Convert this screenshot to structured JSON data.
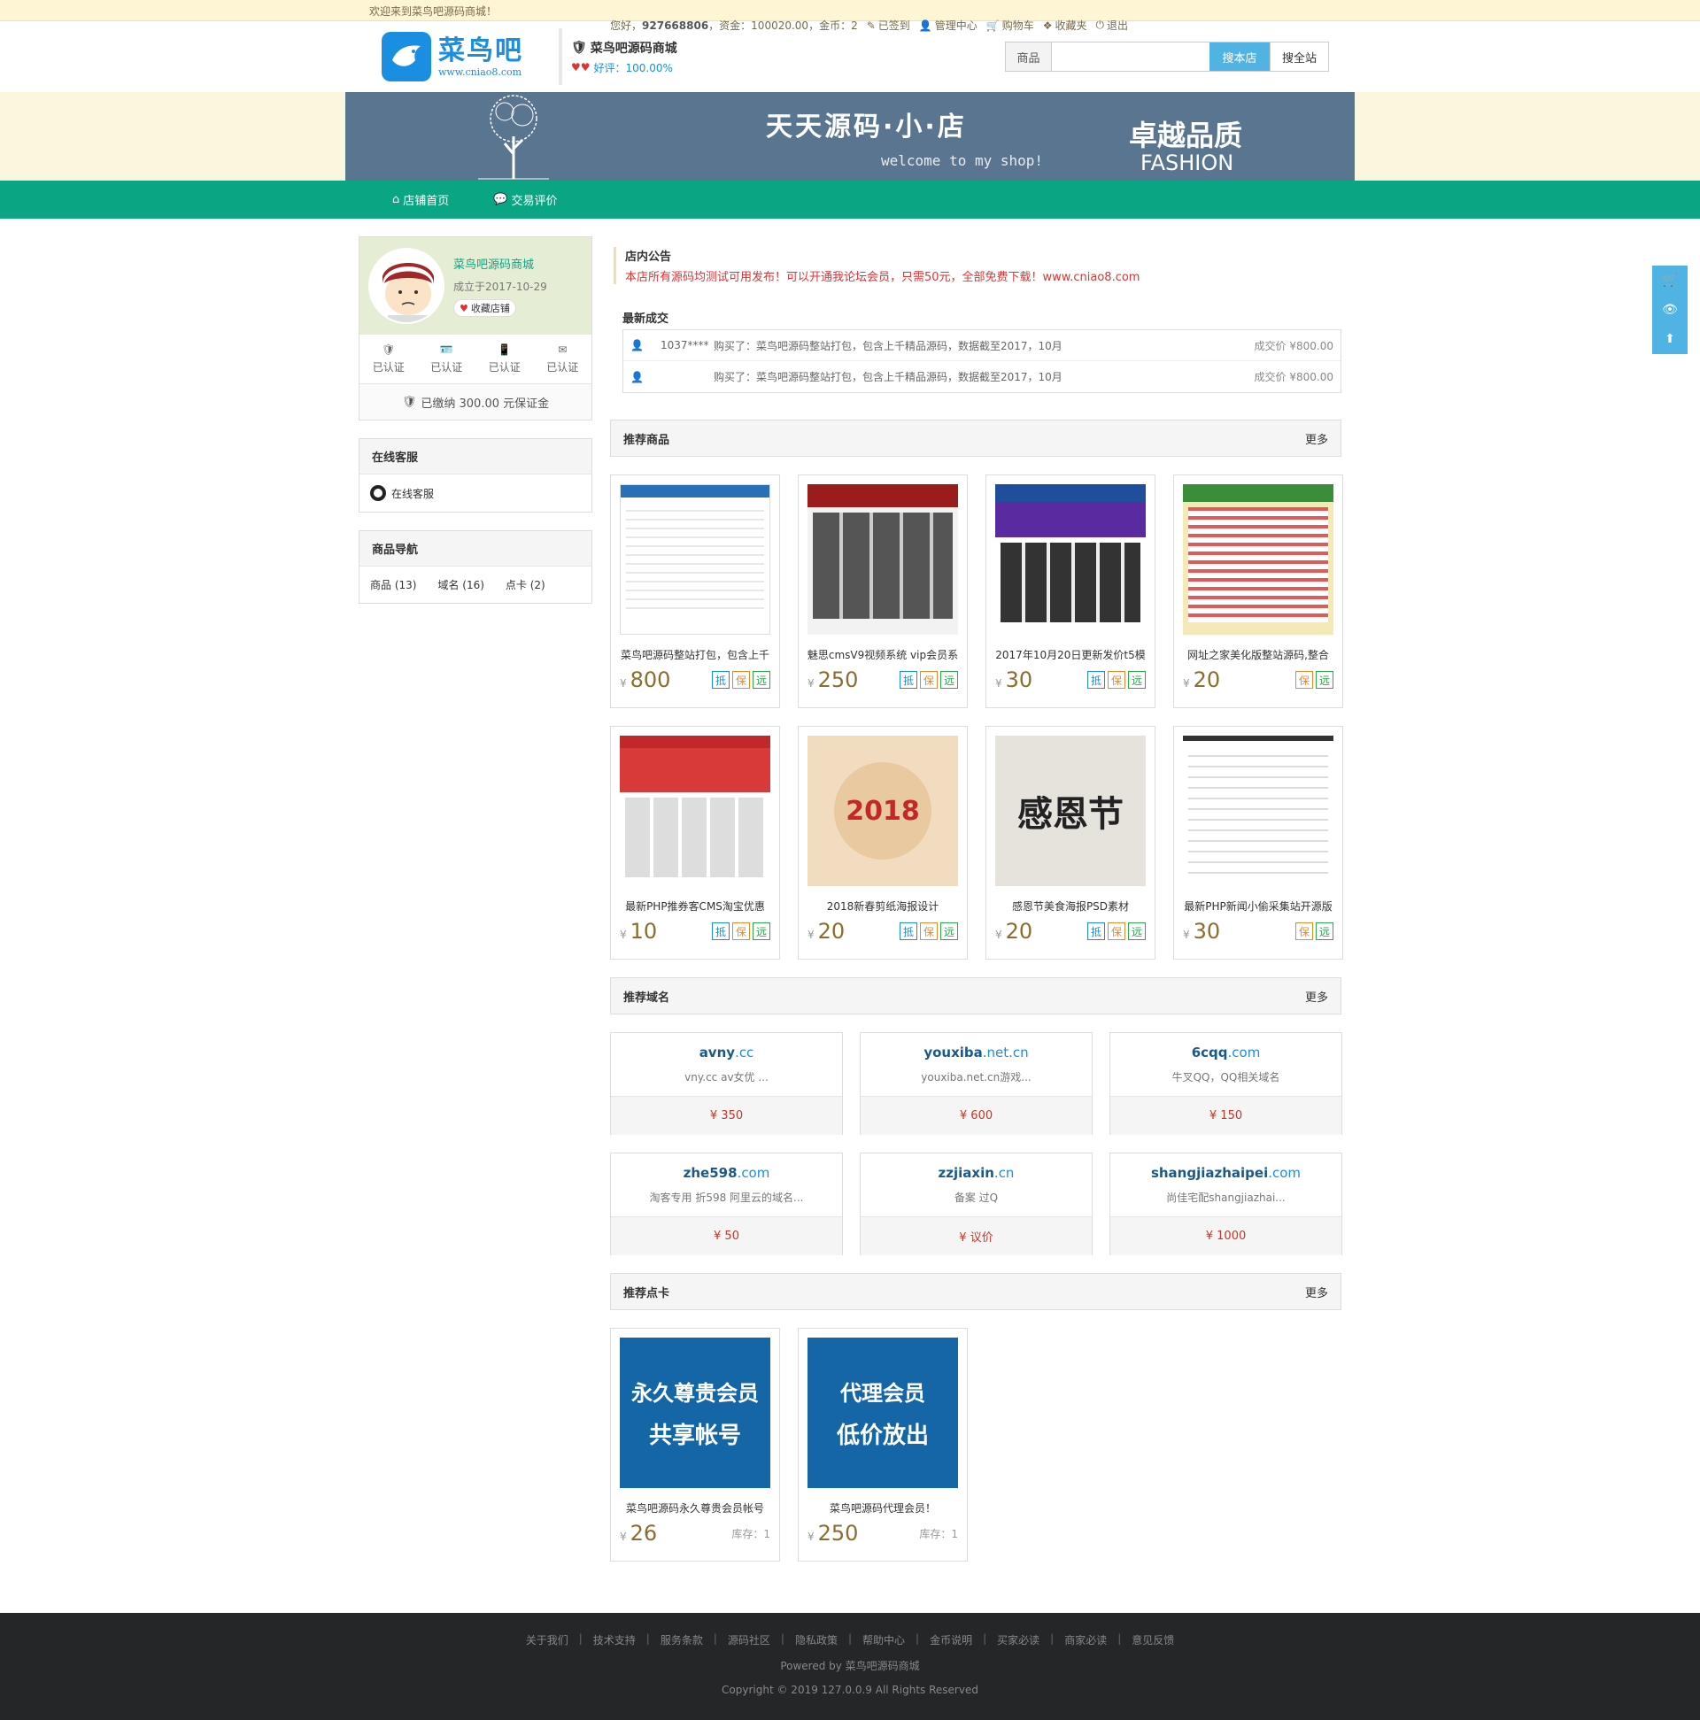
{
  "topbar": {
    "welcome": "欢迎来到菜鸟吧源码商城！",
    "greeting": "您好，",
    "username": "927668806",
    "funds": "，资金：100020.00，金币：2",
    "links": [
      "已签到",
      "管理中心",
      "购物车",
      "收藏夹",
      "退出"
    ]
  },
  "header": {
    "logo_cn": "菜鸟吧",
    "logo_url": "www.cniao8.com",
    "shop_name": "菜鸟吧源码商城",
    "rating": "好评：100.00%",
    "search_category": "商品",
    "search_placeholder": "",
    "search_shop_btn": "搜本店",
    "search_all_btn": "搜全站"
  },
  "banner": {
    "title": "天天源码·小·店",
    "subtitle": "welcome to my shop!",
    "right1": "卓越品质",
    "right2": "FASHION"
  },
  "nav": {
    "items": [
      "店铺首页",
      "交易评价"
    ]
  },
  "shop": {
    "name": "菜鸟吧源码商城",
    "established": "成立于2017-10-29",
    "favorite": "收藏店铺",
    "certs": [
      "已认证",
      "已认证",
      "已认证",
      "已认证"
    ],
    "deposit": "已缴纳 300.00 元保证金"
  },
  "service": {
    "title": "在线客服",
    "item": "在线客服"
  },
  "catnav": {
    "title": "商品导航",
    "items": [
      "商品 (13)",
      "域名 (16)",
      "点卡 (2)"
    ]
  },
  "notice": {
    "title": "店内公告",
    "text": "本店所有源码均测试可用发布！可以开通我论坛会员，只需50元，全部免费下载！www.cniao8.com"
  },
  "deals": {
    "title": "最新成交",
    "rows": [
      {
        "buyer": "1037****",
        "what": "购买了：菜鸟吧源码整站打包，包含上千精品源码，数据截至2017，10月",
        "price": "成交价 ¥800.00"
      },
      {
        "buyer": "",
        "what": "购买了：菜鸟吧源码整站打包，包含上千精品源码，数据截至2017，10月",
        "price": "成交价 ¥800.00"
      }
    ]
  },
  "products": {
    "title": "推荐商品",
    "more": "更多",
    "currency": "¥",
    "items": [
      {
        "title": "菜鸟吧源码整站打包，包含上千",
        "price": "800",
        "tags": [
          "抵",
          "保",
          "远"
        ]
      },
      {
        "title": "魅思cmsV9视频系统 vip会员系",
        "price": "250",
        "tags": [
          "抵",
          "保",
          "远"
        ]
      },
      {
        "title": "2017年10月20日更新发价t5模",
        "price": "30",
        "tags": [
          "抵",
          "保",
          "远"
        ]
      },
      {
        "title": "网址之家美化版整站源码,整合",
        "price": "20",
        "tags": [
          "保",
          "远"
        ]
      },
      {
        "title": "最新PHP推券客CMS淘宝优惠",
        "price": "10",
        "tags": [
          "抵",
          "保",
          "远"
        ]
      },
      {
        "title": "2018新春剪纸海报设计",
        "price": "20",
        "tags": [
          "抵",
          "保",
          "远"
        ]
      },
      {
        "title": "感恩节美食海报PSD素材",
        "price": "20",
        "tags": [
          "抵",
          "保",
          "远"
        ]
      },
      {
        "title": "最新PHP新闻小偷采集站开源版",
        "price": "30",
        "tags": [
          "保",
          "远"
        ]
      }
    ],
    "img_text": {
      "p5": "感恩节",
      "p6": "2018"
    }
  },
  "domains": {
    "title": "推荐域名",
    "more": "更多",
    "items": [
      {
        "name": "avny",
        "tld": ".cc",
        "desc": "vny.cc av女优 ...",
        "price": "¥ 350"
      },
      {
        "name": "youxiba",
        "tld": ".net.cn",
        "desc": "youxiba.net.cn游戏...",
        "price": "¥ 600"
      },
      {
        "name": "6cqq",
        "tld": ".com",
        "desc": "牛叉QQ，QQ相关域名",
        "price": "¥ 150"
      },
      {
        "name": "zhe598",
        "tld": ".com",
        "desc": "淘客专用 折598 阿里云的域名...",
        "price": "¥ 50"
      },
      {
        "name": "zzjiaxin",
        "tld": ".cn",
        "desc": "备案 过Q",
        "price": "¥ 议价"
      },
      {
        "name": "shangjiazhaipei",
        "tld": ".com",
        "desc": "尚佳宅配shangjiazhai...",
        "price": "¥ 1000"
      }
    ]
  },
  "cards": {
    "title": "推荐点卡",
    "more": "更多",
    "currency": "¥",
    "items": [
      {
        "img1": "永久尊贵会员",
        "img2": "共享帐号",
        "title": "菜鸟吧源码永久尊贵会员帐号",
        "price": "26",
        "stock": "库存：1"
      },
      {
        "img1": "代理会员",
        "img2": "低价放出",
        "title": "菜鸟吧源码代理会员！",
        "price": "250",
        "stock": "库存：1"
      }
    ]
  },
  "footer": {
    "links": [
      "关于我们",
      "技术支持",
      "服务条款",
      "源码社区",
      "隐私政策",
      "帮助中心",
      "金币说明",
      "买家必读",
      "商家必读",
      "意见反馈"
    ],
    "powered": "Powered by 菜鸟吧源码商城",
    "copyright": "Copyright © 2019 127.0.0.9 All Rights Reserved"
  },
  "colors": {
    "accent": "#0aa583",
    "blue": "#4fb3e3",
    "price": "#8c6d2c",
    "notice": "#dd3333"
  }
}
